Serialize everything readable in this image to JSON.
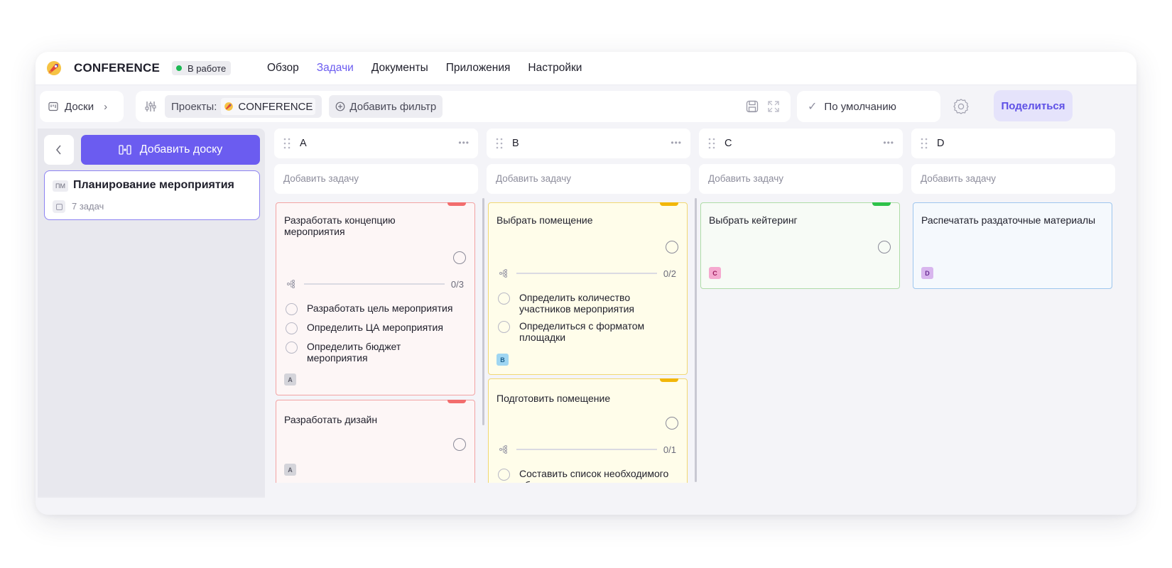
{
  "nav": {
    "project_title": "CONFERENCE",
    "status": "В работе",
    "links": [
      "Обзор",
      "Задачи",
      "Документы",
      "Приложения",
      "Настройки"
    ]
  },
  "toolbar": {
    "boards_label": "Доски",
    "projects_label": "Проекты:",
    "project_chip": "CONFERENCE",
    "add_filter": "Добавить фильтр",
    "view_preset": "По умолчанию",
    "share": "Поделиться"
  },
  "sidebar": {
    "add_board": "Добавить доску",
    "board_abbr": "ПМ",
    "board_name": "Планирование мероприятия",
    "board_count": "7 задач"
  },
  "columns": [
    {
      "title": "A",
      "add_task": "Добавить задачу",
      "cards": [
        {
          "title": "Разработать концепцию мероприятия",
          "progress_text": "0/3",
          "subtasks": [
            "Разработать цель мероприятия",
            "Определить ЦА мероприятия",
            "Определить бюджет мероприятия"
          ],
          "tag": "A"
        },
        {
          "title": "Разработать дизайн",
          "tag": "A"
        }
      ]
    },
    {
      "title": "B",
      "add_task": "Добавить задачу",
      "cards": [
        {
          "title": "Выбрать помещение",
          "progress_text": "0/2",
          "subtasks": [
            "Определить количество участников мероприятия",
            "Определиться с форматом площадки"
          ],
          "tag": "B"
        },
        {
          "title": "Подготовить помещение",
          "progress_text": "0/1",
          "subtasks": [
            "Составить список необходимого оборудования"
          ]
        }
      ]
    },
    {
      "title": "C",
      "add_task": "Добавить задачу",
      "cards": [
        {
          "title": "Выбрать кейтеринг",
          "tag": "C"
        }
      ]
    },
    {
      "title": "D",
      "add_task": "Добавить задачу",
      "cards": [
        {
          "title": "Распечатать раздаточные материалы",
          "tag": "D"
        }
      ]
    }
  ],
  "colors": {
    "accent": "#6b5cf0",
    "status_green": "#1db954",
    "priority_red": "#f26d6d",
    "priority_yellow": "#f2b70a",
    "priority_green": "#2fc24a"
  }
}
